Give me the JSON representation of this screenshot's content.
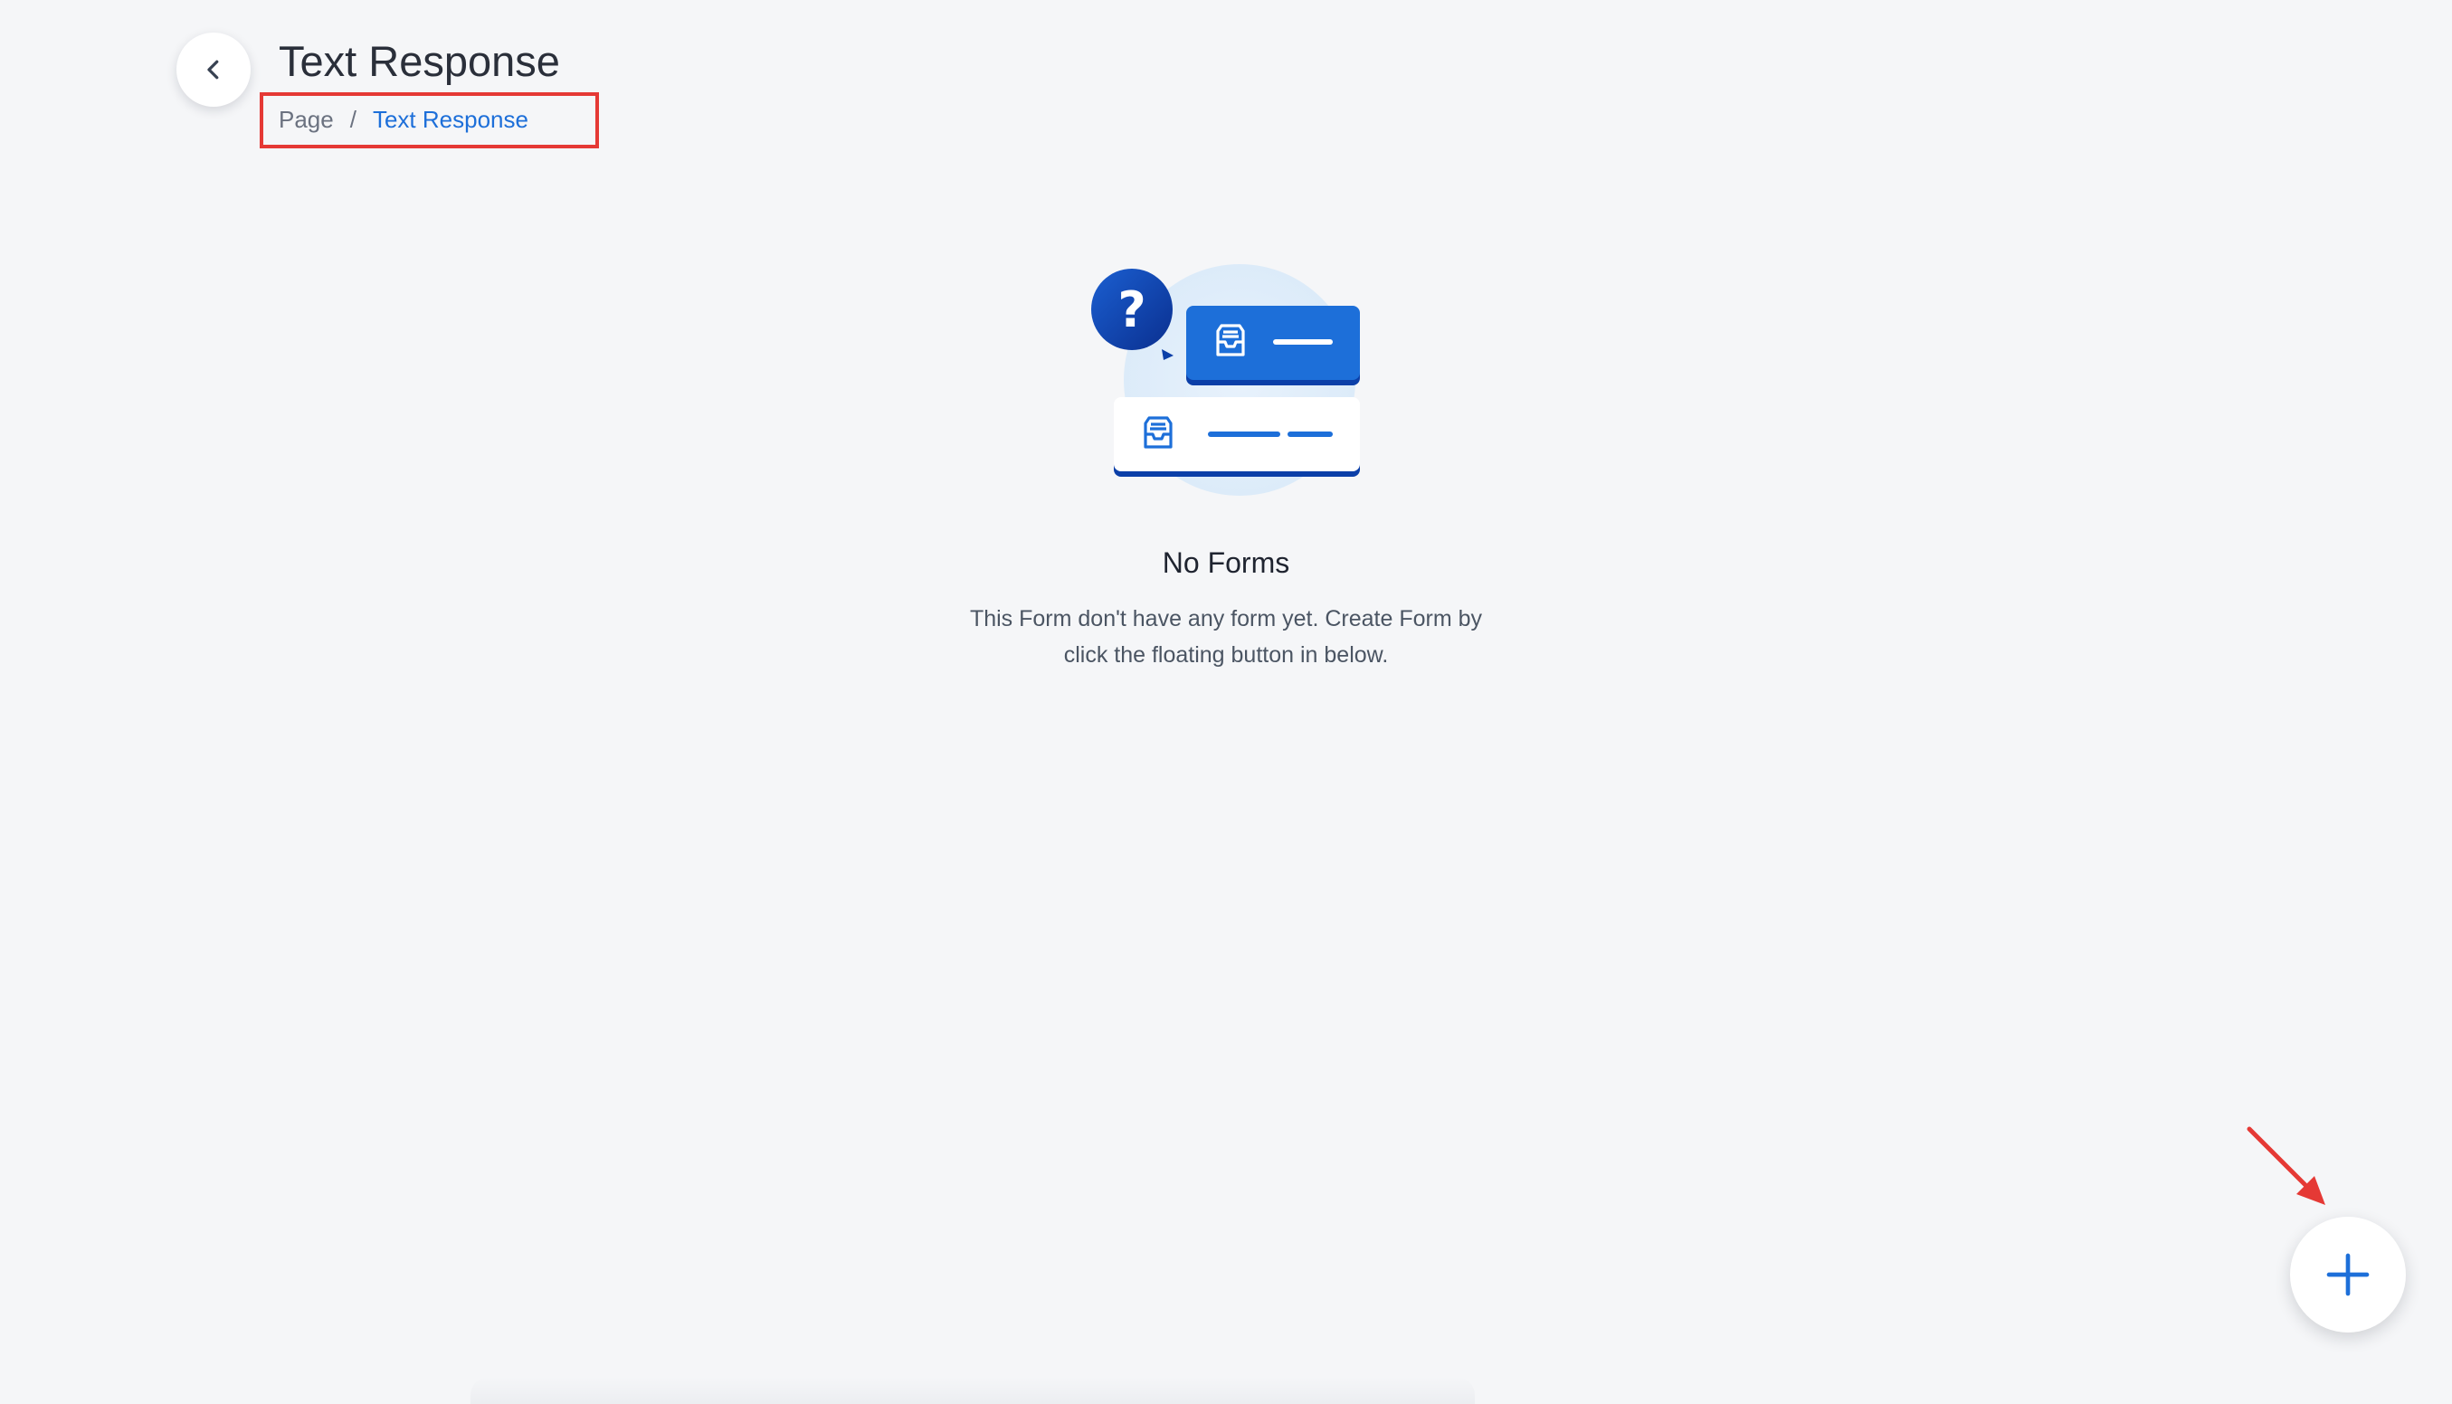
{
  "header": {
    "title": "Text Response",
    "back_icon": "chevron-left-icon"
  },
  "breadcrumb": {
    "items": [
      "Page",
      "Text Response"
    ],
    "separator": "/"
  },
  "empty_state": {
    "illustration": "forms-empty-illustration",
    "title": "No Forms",
    "description_lines": [
      "This Form don't have any form yet. Create Form by",
      "click the floating button in below."
    ]
  },
  "fab": {
    "icon": "plus-icon"
  },
  "colors": {
    "background": "#f5f6f8",
    "accent": "#1d6fd9",
    "dark_blue": "#0b3fa8",
    "annotation": "#e53935"
  }
}
